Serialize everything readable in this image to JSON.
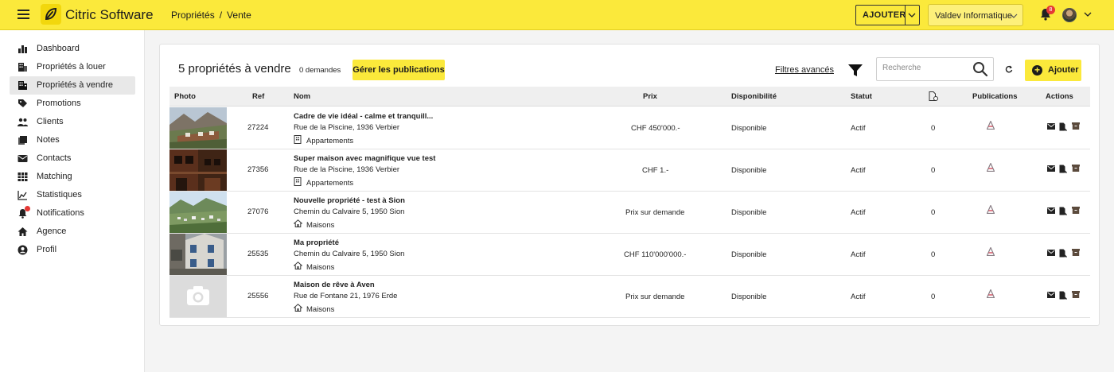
{
  "app": {
    "brand": "Citric Software",
    "breadcrumb": [
      "Propriétés",
      "/",
      "Vente"
    ],
    "add_button": "AJOUTER",
    "agency": "Valdev Informatique",
    "notifications_count": "8",
    "accent_color": "#fbe93b"
  },
  "sidebar": {
    "items": [
      {
        "label": "Dashboard",
        "icon": "bar-chart-icon"
      },
      {
        "label": "Propriétés à louer",
        "icon": "building-icon"
      },
      {
        "label": "Propriétés à vendre",
        "icon": "building-icon",
        "active": true
      },
      {
        "label": "Promotions",
        "icon": "tag-icon"
      },
      {
        "label": "Clients",
        "icon": "people-icon"
      },
      {
        "label": "Notes",
        "icon": "notes-icon"
      },
      {
        "label": "Contacts",
        "icon": "mail-icon"
      },
      {
        "label": "Matching",
        "icon": "grid-icon"
      },
      {
        "label": "Statistiques",
        "icon": "line-chart-icon"
      },
      {
        "label": "Notifications",
        "icon": "bell-icon"
      },
      {
        "label": "Agence",
        "icon": "home-icon"
      },
      {
        "label": "Profil",
        "icon": "account-icon"
      }
    ]
  },
  "main": {
    "title": "5 propriétés à vendre",
    "demandes": "0 demandes",
    "publications_button": "Gérer les publications",
    "filters_link": "Filtres avancés",
    "search_placeholder": "Recherche",
    "add_button": "Ajouter"
  },
  "table": {
    "headers": {
      "photo": "Photo",
      "ref": "Ref",
      "nom": "Nom",
      "prix": "Prix",
      "disponibilite": "Disponibilité",
      "statut": "Statut",
      "publications": "Publications",
      "actions": "Actions"
    },
    "rows": [
      {
        "ref": "27224",
        "title": "Cadre de vie idéal - calme et tranquill...",
        "address": "Rue de la Piscine, 1936 Verbier",
        "type": "Appartements",
        "price": "CHF 450'000.-",
        "availability": "Disponible",
        "status": "Actif",
        "count": "0",
        "photo": "mountain-village"
      },
      {
        "ref": "27356",
        "title": "Super maison avec magnifique vue test",
        "address": "Rue de la Piscine, 1936 Verbier",
        "type": "Appartements",
        "price": "CHF 1.-",
        "availability": "Disponible",
        "status": "Actif",
        "count": "0",
        "photo": "wooden-chalet"
      },
      {
        "ref": "27076",
        "title": "Nouvelle propriété - test à Sion",
        "address": "Chemin du Calvaire 5, 1950 Sion",
        "type": "Maisons",
        "price": "Prix sur demande",
        "availability": "Disponible",
        "status": "Actif",
        "count": "0",
        "photo": "valley-town"
      },
      {
        "ref": "25535",
        "title": "Ma propriété",
        "address": "Chemin du Calvaire 5, 1950 Sion",
        "type": "Maisons",
        "price": "CHF 110'000'000.-",
        "availability": "Disponible",
        "status": "Actif",
        "count": "0",
        "photo": "stone-house"
      },
      {
        "ref": "25556",
        "title": "Maison de rêve à Aven",
        "address": "Rue de Fontane 21, 1976 Erde",
        "type": "Maisons",
        "price": "Prix sur demande",
        "availability": "Disponible",
        "status": "Actif",
        "count": "0",
        "photo": "placeholder"
      }
    ]
  }
}
